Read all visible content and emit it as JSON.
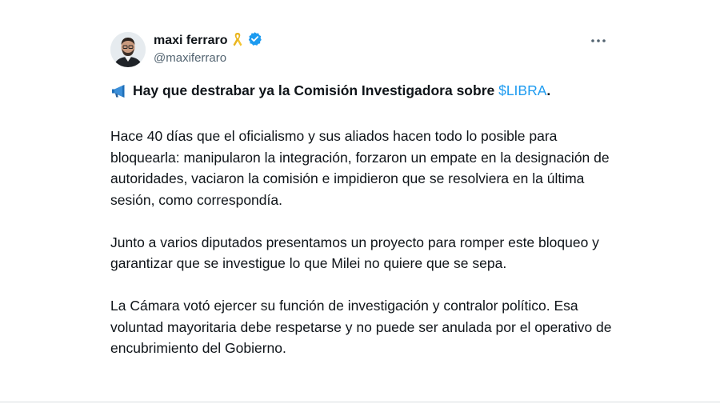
{
  "author": {
    "name": "maxi ferraro",
    "handle": "@maxiferraro"
  },
  "icons": {
    "ribbon": "yellow-ribbon-icon",
    "verified": "verified-badge-icon",
    "more": "more-options-icon",
    "megaphone": "megaphone-icon"
  },
  "colors": {
    "text": "#0f1419",
    "secondary": "#536471",
    "accent": "#1d9bf0",
    "ribbon": "#f4c430"
  },
  "tweet": {
    "headline_text": "Hay que destrabar ya la Comisión Investigadora sobre ",
    "headline_cashtag": "$LIBRA",
    "headline_end": ".",
    "paragraph_1": "Hace 40 días que el oficialismo y sus aliados hacen todo lo posible para bloquearla: manipularon la integración, forzaron un empate en la designación de autoridades, vaciaron la comisión e impidieron que se resolviera en la última sesión, como correspondía.",
    "paragraph_2": "Junto a varios diputados presentamos un proyecto para romper este bloqueo y garantizar que se investigue lo que Milei no quiere que se sepa.",
    "paragraph_3": "La Cámara votó ejercer su función de investigación y contralor político. Esa voluntad mayoritaria debe respetarse y no puede ser anulada por el operativo de encubrimiento del Gobierno."
  }
}
